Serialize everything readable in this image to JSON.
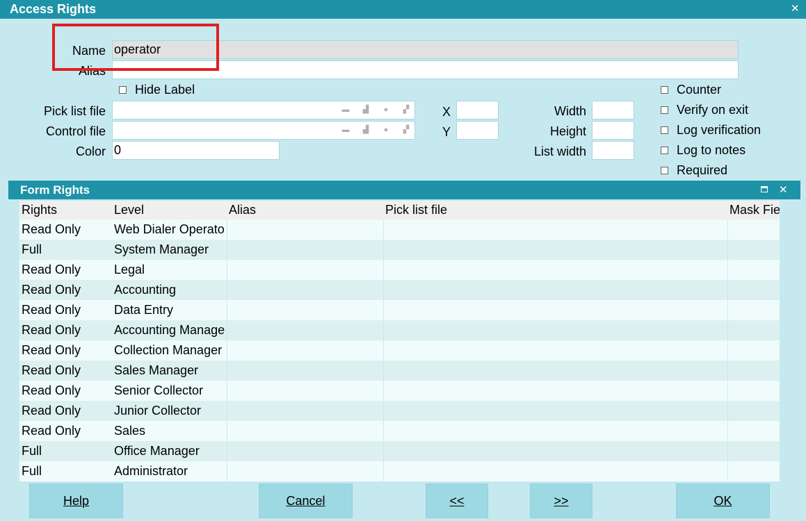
{
  "window": {
    "title": "Access Rights"
  },
  "form": {
    "name_label": "Name",
    "name_value": "operator",
    "alias_label": "Alias",
    "alias_value": "",
    "hide_label": "Hide Label",
    "pick_list_label": "Pick list file",
    "control_file_label": "Control file",
    "color_label": "Color",
    "color_value": "0",
    "x_label": "X",
    "y_label": "Y",
    "width_label": "Width",
    "height_label": "Height",
    "list_width_label": "List width",
    "checkboxes": {
      "counter": "Counter",
      "verify_on_exit": "Verify on exit",
      "log_verification": "Log verification",
      "log_to_notes": "Log to notes",
      "required": "Required"
    }
  },
  "form_rights": {
    "title": "Form Rights",
    "columns": [
      "Rights",
      "Level",
      "Alias",
      "Pick list file",
      "Mask Fie"
    ],
    "rows": [
      [
        "Read Only",
        "Web Dialer Operato"
      ],
      [
        "Full",
        "System Manager"
      ],
      [
        "Read Only",
        "Legal"
      ],
      [
        "Read Only",
        "Accounting"
      ],
      [
        "Read Only",
        "Data Entry"
      ],
      [
        "Read Only",
        "Accounting Manage"
      ],
      [
        "Read Only",
        "Collection Manager"
      ],
      [
        "Read Only",
        "Sales Manager"
      ],
      [
        "Read Only",
        "Senior Collector"
      ],
      [
        "Read Only",
        "Junior Collector"
      ],
      [
        "Read Only",
        "Sales"
      ],
      [
        "Full",
        "Office Manager"
      ],
      [
        "Full",
        "Administrator"
      ]
    ]
  },
  "buttons": {
    "help": "Help",
    "cancel": "Cancel",
    "prev": "<<",
    "next": ">>",
    "ok": "OK"
  }
}
